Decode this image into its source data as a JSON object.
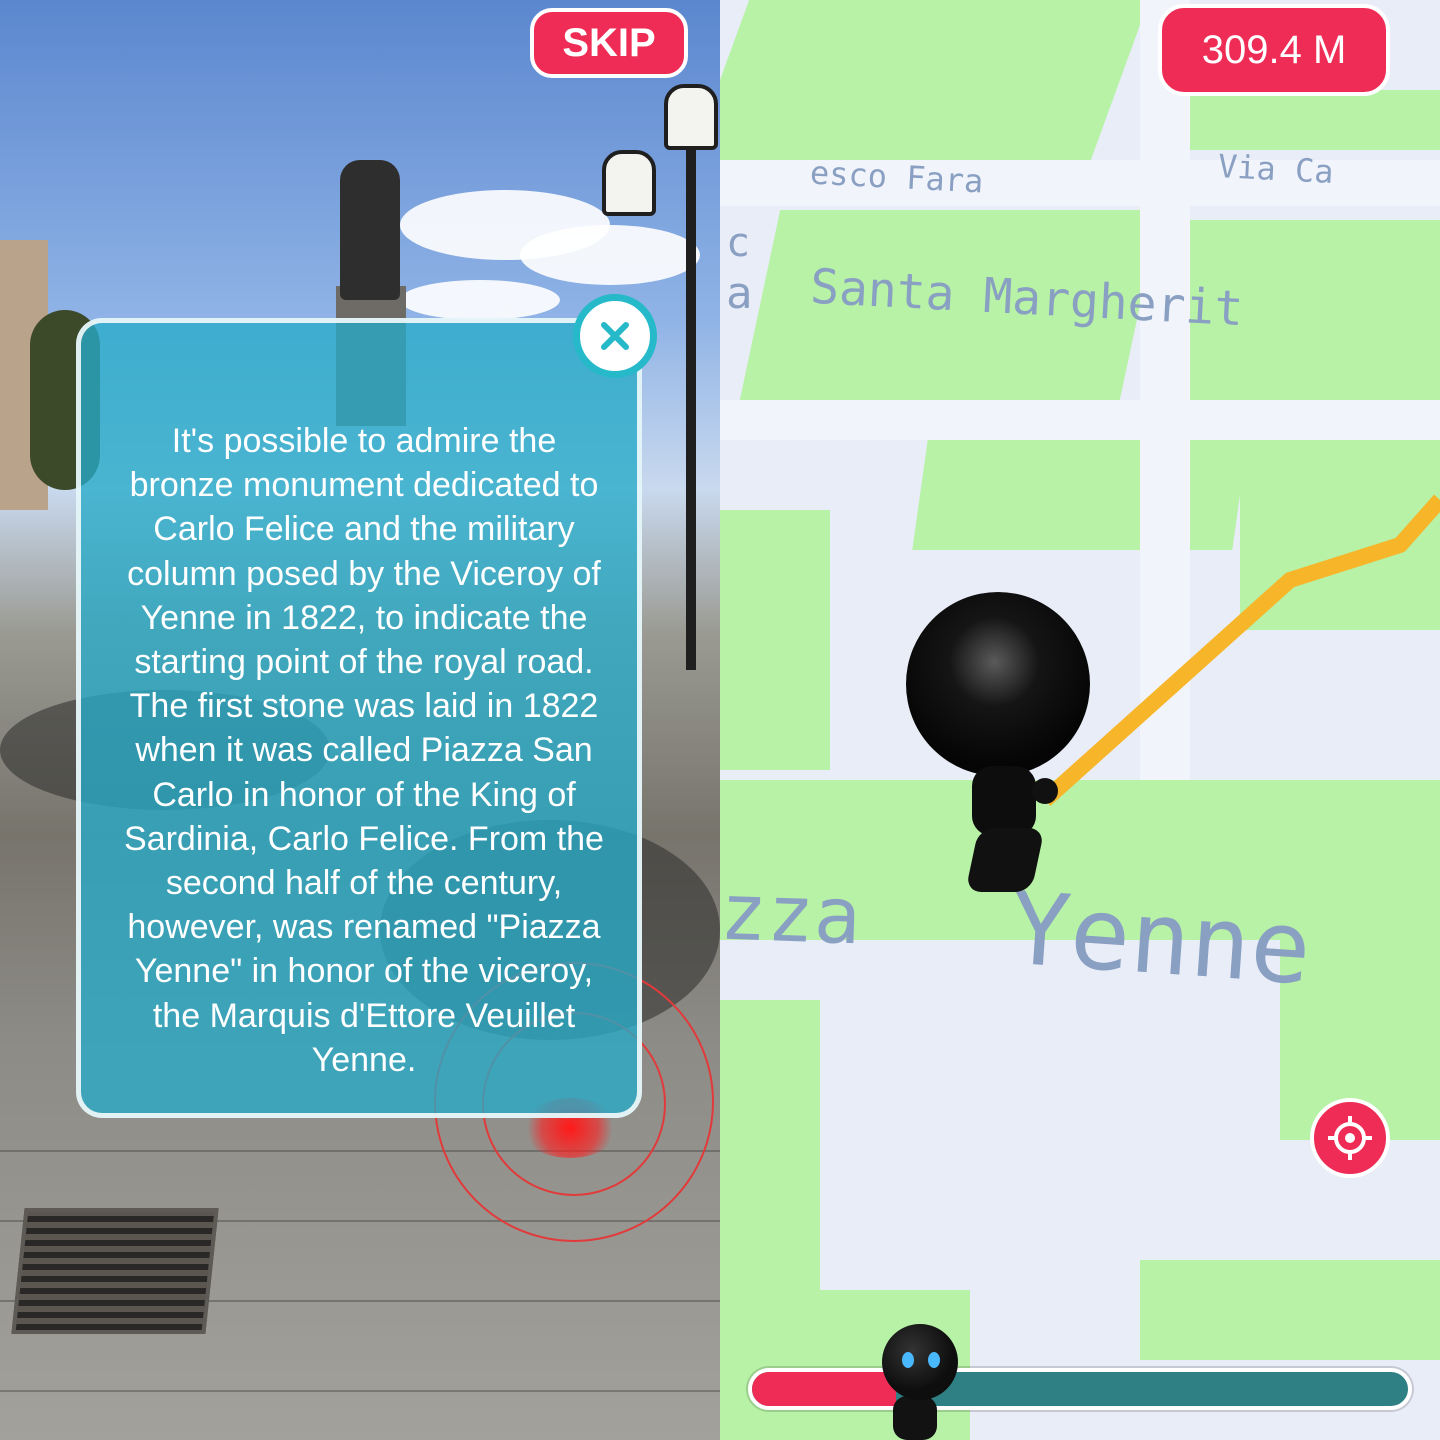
{
  "ar_view": {
    "skip_label": "SKIP",
    "close_icon": "close-icon",
    "info_lines": [
      "It's possible to admire the",
      "bronze monument dedicated to",
      "Carlo Felice and the military",
      "column posed by the Viceroy of",
      "Yenne in 1822, to indicate the",
      "starting point of the royal road.",
      "The first stone was laid in 1822",
      "when it was called Piazza San",
      "Carlo in honor of the King of",
      "Sardinia, Carlo Felice. From the",
      "second half of the century,",
      "however, was renamed \"Piazza",
      "Yenne\" in honor of the viceroy,",
      "the Marquis d'Ettore Veuillet",
      "Yenne."
    ]
  },
  "map_view": {
    "distance": "309.4 M",
    "street_labels": {
      "francesco": "esco Fara",
      "via_ca": "Via Ca",
      "santa_margherita": "Santa Margherit",
      "piazza": "zza",
      "yenne": "Yenne",
      "c_fragment": "c",
      "a_fragment": "a"
    },
    "locate_icon": "crosshair-icon",
    "progress_fraction": 0.22,
    "colors": {
      "accent": "#ee2c55",
      "route": "#f7b52a",
      "progress_track": "#2f8085",
      "park_green": "#b7f2a6"
    }
  }
}
